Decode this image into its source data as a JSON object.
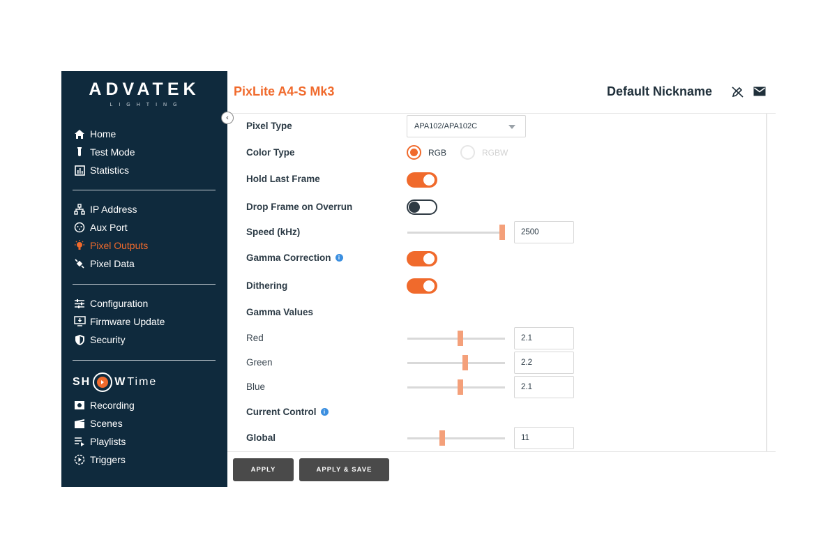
{
  "sidebar": {
    "brand": "ADVATEK",
    "brand_sub": "LIGHTING",
    "group1": [
      {
        "label": "Home",
        "icon": "home-icon"
      },
      {
        "label": "Test Mode",
        "icon": "test-tube-icon"
      },
      {
        "label": "Statistics",
        "icon": "chart-icon"
      }
    ],
    "group2": [
      {
        "label": "IP Address",
        "icon": "network-icon"
      },
      {
        "label": "Aux Port",
        "icon": "port-icon"
      },
      {
        "label": "Pixel Outputs",
        "icon": "bulb-icon",
        "active": true
      },
      {
        "label": "Pixel Data",
        "icon": "satellite-icon"
      }
    ],
    "group3": [
      {
        "label": "Configuration",
        "icon": "sliders-icon"
      },
      {
        "label": "Firmware Update",
        "icon": "monitor-download-icon"
      },
      {
        "label": "Security",
        "icon": "shield-icon"
      }
    ],
    "showtime": {
      "part1": "SH",
      "part2": "W",
      "part3": "Time"
    },
    "group4": [
      {
        "label": "Recording",
        "icon": "record-icon"
      },
      {
        "label": "Scenes",
        "icon": "clapper-icon"
      },
      {
        "label": "Playlists",
        "icon": "playlist-icon"
      },
      {
        "label": "Triggers",
        "icon": "trigger-icon"
      }
    ]
  },
  "header": {
    "device_title": "PixLite A4-S Mk3",
    "nickname": "Default Nickname"
  },
  "form": {
    "pixel_type_label": "Pixel Type",
    "pixel_type_value": "APA102/APA102C",
    "color_type_label": "Color Type",
    "color_rgb": "RGB",
    "color_rgbw": "RGBW",
    "hold_last_frame_label": "Hold Last Frame",
    "drop_frame_label": "Drop Frame on Overrun",
    "speed_label": "Speed (kHz)",
    "speed_value": "2500",
    "gamma_correction_label": "Gamma Correction",
    "dithering_label": "Dithering",
    "gamma_values_label": "Gamma Values",
    "red_label": "Red",
    "red_value": "2.1",
    "green_label": "Green",
    "green_value": "2.2",
    "blue_label": "Blue",
    "blue_value": "2.1",
    "current_control_label": "Current Control",
    "global_label": "Global",
    "global_value": "11",
    "info_glyph": "i"
  },
  "buttons": {
    "apply": "APPLY",
    "apply_save": "APPLY & SAVE"
  },
  "colors": {
    "accent": "#f06a2c",
    "sidebar_bg": "#0f2a3d",
    "button_bg": "#4a4a4a"
  }
}
